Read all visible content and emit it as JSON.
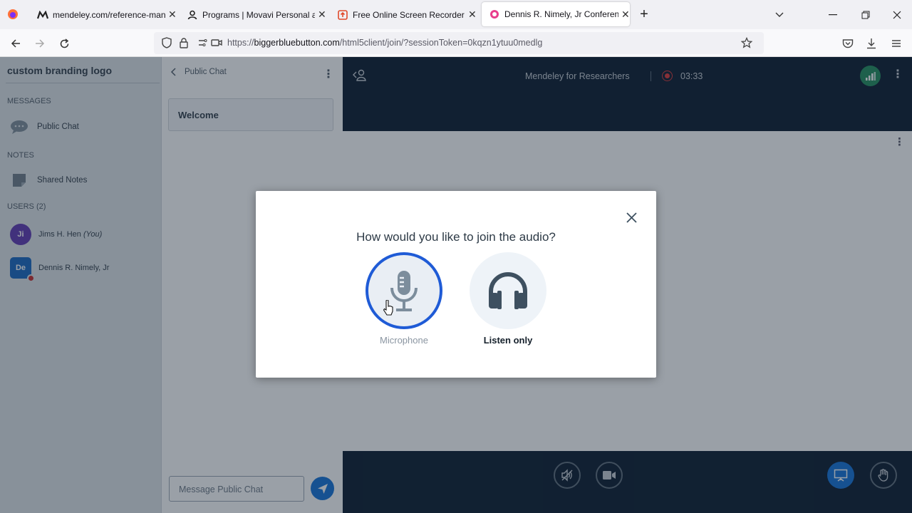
{
  "browser": {
    "tabs": [
      {
        "title": "mendeley.com/reference-mana",
        "active": false
      },
      {
        "title": "Programs | Movavi Personal acc",
        "active": false
      },
      {
        "title": "Free Online Screen Recorder | O",
        "active": false
      },
      {
        "title": "Dennis R. Nimely, Jr Conference",
        "active": true
      }
    ],
    "url_prefix": "https://",
    "url_domain": "biggerbluebutton.com",
    "url_path": "/html5client/join/?sessionToken=0kqzn1ytuu0medlg"
  },
  "sidebar": {
    "logo_text": "custom branding logo",
    "messages_heading": "MESSAGES",
    "public_chat_label": "Public Chat",
    "notes_heading": "NOTES",
    "shared_notes_label": "Shared Notes",
    "users_heading": "USERS (2)",
    "users": [
      {
        "initials": "Ji",
        "name": "Jims H. Hen",
        "suffix": "(You)",
        "color": "#5e35b1"
      },
      {
        "initials": "De",
        "name": "Dennis R. Nimely, Jr",
        "suffix": "",
        "color": "#1565c0"
      }
    ]
  },
  "chat": {
    "header_label": "Public Chat",
    "welcome_text": "Welcome",
    "input_placeholder": "Message Public Chat"
  },
  "meeting": {
    "title": "Mendeley for Researchers",
    "timer": "03:33"
  },
  "modal": {
    "title": "How would you like to join the audio?",
    "microphone_label": "Microphone",
    "listen_only_label": "Listen only"
  },
  "colors": {
    "primary": "#0f70d7",
    "dark_nav": "#06172a",
    "mic_ring": "#1f5bd6",
    "icon_gray": "#3e5060"
  }
}
